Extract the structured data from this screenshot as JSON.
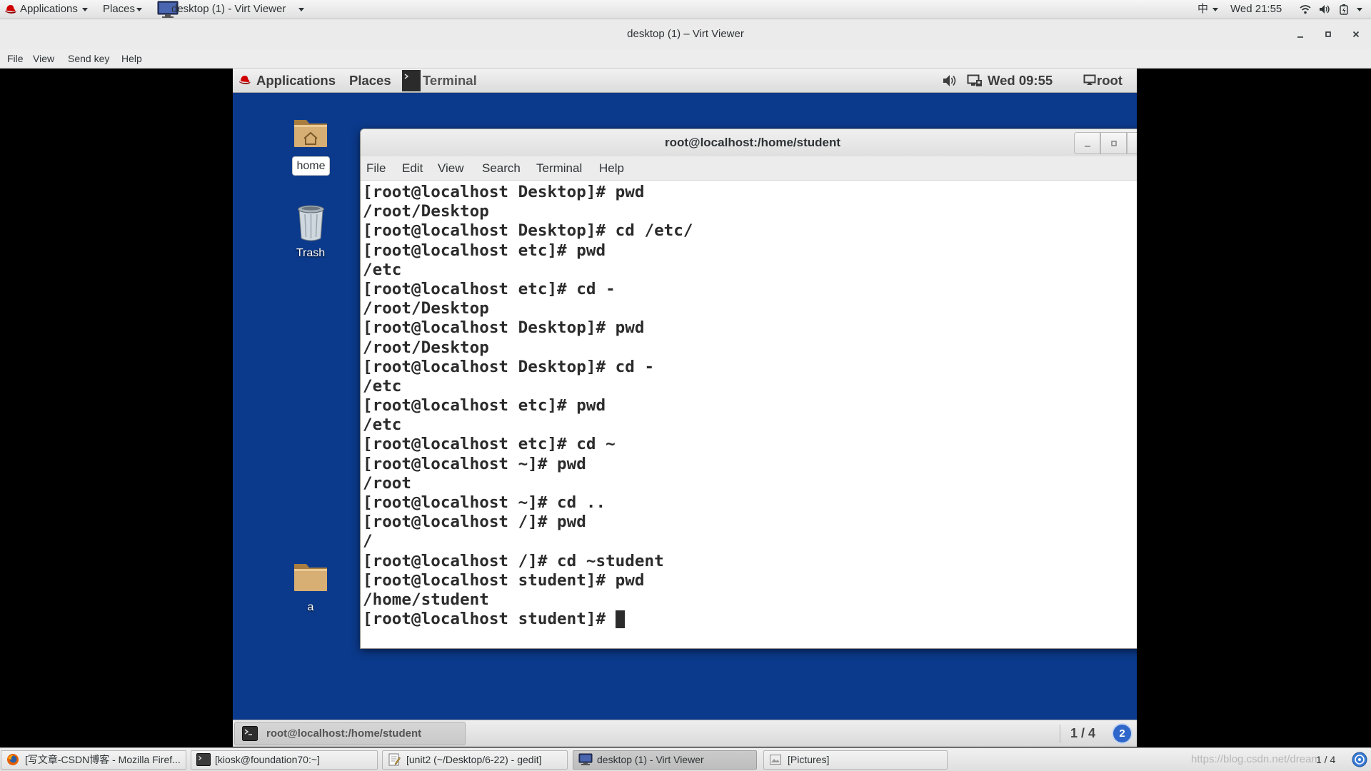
{
  "host_panel": {
    "applications": "Applications",
    "places": "Places",
    "active_window": "desktop (1) - Virt Viewer",
    "input_method": "中",
    "clock": "Wed 21:55",
    "icons": [
      "redhat-icon",
      "virt-viewer-icon",
      "wifi-icon",
      "volume-icon",
      "power-icon"
    ]
  },
  "viewer_window": {
    "title": "desktop (1) – Virt Viewer",
    "menu": {
      "file": "File",
      "view": "View",
      "send_key": "Send key",
      "help": "Help"
    }
  },
  "guest": {
    "top_panel": {
      "applications": "Applications",
      "places": "Places",
      "active_window": "Terminal",
      "clock": "Wed 09:55",
      "user": "root"
    },
    "desktop_icons": [
      {
        "label": "home",
        "icon": "home-folder-icon"
      },
      {
        "label": "Trash",
        "icon": "trash-icon"
      },
      {
        "label": "a",
        "icon": "folder-icon"
      }
    ],
    "terminal": {
      "title": "root@localhost:/home/student",
      "menu": [
        "File",
        "Edit",
        "View",
        "Search",
        "Terminal",
        "Help"
      ],
      "lines": [
        "[root@localhost Desktop]# pwd",
        "/root/Desktop",
        "[root@localhost Desktop]# cd /etc/",
        "[root@localhost etc]# pwd",
        "/etc",
        "[root@localhost etc]# cd -",
        "/root/Desktop",
        "[root@localhost Desktop]# pwd",
        "/root/Desktop",
        "[root@localhost Desktop]# cd -",
        "/etc",
        "[root@localhost etc]# pwd",
        "/etc",
        "[root@localhost etc]# cd ~",
        "[root@localhost ~]# pwd",
        "/root",
        "[root@localhost ~]# cd ..",
        "[root@localhost /]# pwd",
        "/",
        "[root@localhost /]# cd ~student",
        "[root@localhost student]# pwd",
        "/home/student",
        "[root@localhost student]# "
      ]
    },
    "bottom_panel": {
      "task": "root@localhost:/home/student",
      "workspace": "1 / 4",
      "notification_count": "2"
    }
  },
  "host_taskbar": {
    "items": [
      {
        "label": "[写文章-CSDN博客 - Mozilla Firef...",
        "icon": "firefox-icon",
        "active": false
      },
      {
        "label": "[kiosk@foundation70:~]",
        "icon": "terminal-icon",
        "active": false
      },
      {
        "label": "[unit2 (~/Desktop/6-22) - gedit]",
        "icon": "gedit-icon",
        "active": false
      },
      {
        "label": "desktop (1) - Virt Viewer",
        "icon": "virt-viewer-icon",
        "active": true
      },
      {
        "label": "[Pictures]",
        "icon": "pictures-icon",
        "active": false
      }
    ],
    "workspace": "1 / 4",
    "watermark": "https://blog.csdn.net/dream"
  },
  "colors": {
    "guest_desktop": "#0b3a8c",
    "terminal_background": "#ffffff",
    "terminal_text": "#2b2b2b",
    "notification_badge": "#2f66c9"
  }
}
